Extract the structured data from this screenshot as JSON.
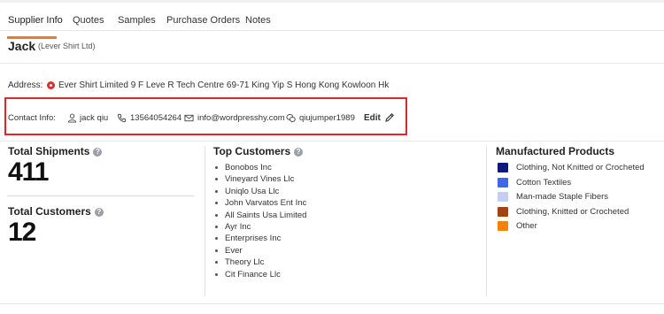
{
  "tabs": [
    {
      "label": "Supplier Info",
      "active": true
    },
    {
      "label": "Quotes"
    },
    {
      "label": "Samples"
    },
    {
      "label": "Purchase Orders"
    },
    {
      "label": "Notes"
    }
  ],
  "header": {
    "name": "Jack",
    "company": "(Lever Shirt Ltd)"
  },
  "address": {
    "label": "Address:",
    "value": "Ever Shirt Limited 9 F Leve R Tech Centre 69-71 King Yip S Hong Kong Kowloon Hk"
  },
  "contact": {
    "label": "Contact Info:",
    "person": "jack qiu",
    "phone": "13564054264",
    "email": "info@wordpresshy.com",
    "chat": "qiujumper1989",
    "edit_label": "Edit"
  },
  "stats": {
    "shipments_title": "Total Shipments",
    "shipments_value": "411",
    "customers_title": "Total Customers",
    "customers_value": "12"
  },
  "top_customers": {
    "title": "Top Customers",
    "items": [
      "Bonobos Inc",
      "Vineyard Vines Llc",
      "Uniqlo Usa Llc",
      "John Varvatos Ent Inc",
      "All Saints Usa Limited",
      "Ayr Inc",
      "Enterprises Inc",
      "Ever",
      "Theory Llc",
      "Cit Finance Llc"
    ]
  },
  "products": {
    "title": "Manufactured Products",
    "items": [
      {
        "label": "Clothing, Not Knitted or Crocheted",
        "color": "#0d1a7a"
      },
      {
        "label": "Cotton Textiles",
        "color": "#3f67e8"
      },
      {
        "label": "Man-made Staple Fibers",
        "color": "#c4cef3"
      },
      {
        "label": "Clothing, Knitted or Crocheted",
        "color": "#a0450f"
      },
      {
        "label": "Other",
        "color": "#f2830f"
      }
    ]
  },
  "colors": {
    "accent": "#f07a22",
    "highlight_border": "#e0252b",
    "pin": "#d9322b"
  }
}
